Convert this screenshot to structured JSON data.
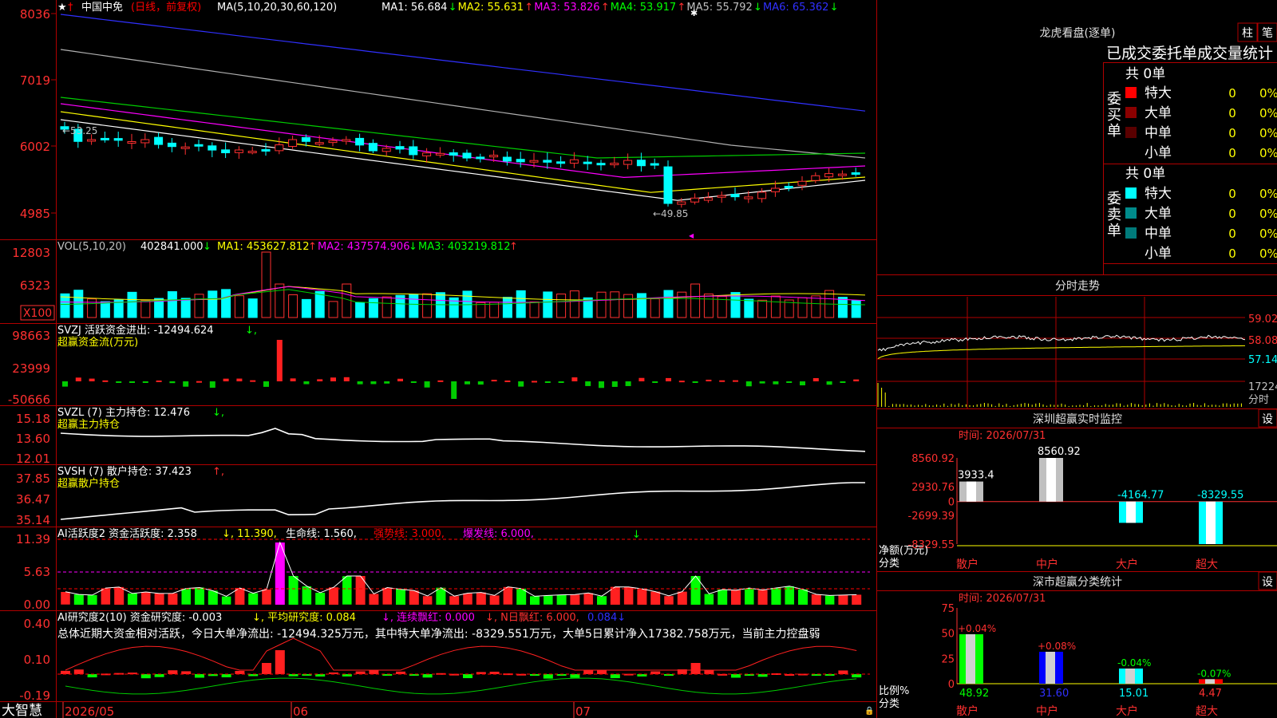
{
  "window": {
    "brand": "大智慧"
  },
  "main_chart": {
    "symbol": "中国中免",
    "mode": "(日线，前复权)",
    "ma_title": "MA(5,10,20,30,60,120)",
    "ma": [
      {
        "label": "MA1: 56.684",
        "arrow": "↓",
        "color": "#ffffff"
      },
      {
        "label": "MA2: 55.631",
        "arrow": "↑",
        "color": "#ffff00"
      },
      {
        "label": "MA3: 53.826",
        "arrow": "↑",
        "color": "#ff00ff"
      },
      {
        "label": "MA4: 53.917",
        "arrow": "↑",
        "color": "#00ff00"
      },
      {
        "label": "MA5: 55.792",
        "arrow": "↓",
        "color": "#c0c0c0"
      },
      {
        "label": "MA6: 65.362",
        "arrow": "↓",
        "color": "#3030ff"
      }
    ],
    "y_labels": [
      "8036",
      "7019",
      "6002",
      "4985"
    ],
    "high_label": "←53.25",
    "low_label": "←49.85"
  },
  "vol": {
    "title": "VOL(5,10,20)",
    "value": "402841.000",
    "value_arrow": "↓",
    "ma": [
      {
        "label": "MA1: 453627.812",
        "arrow": "↑",
        "color": "#ffff00"
      },
      {
        "label": "MA2: 437574.906",
        "arrow": "↓",
        "color": "#ff00ff"
      },
      {
        "label": "MA3: 403219.812",
        "arrow": "↑",
        "color": "#00ff00"
      }
    ],
    "y_labels": [
      "12803",
      "6323"
    ],
    "unit": "X100"
  },
  "svzj": {
    "title": "SVZJ  活跃资金进出: -12494.624",
    "arrow": "↓,",
    "subtitle": "超赢资金流(万元)",
    "y_labels": [
      "98663",
      "23999",
      "-50666"
    ]
  },
  "svzl": {
    "title": "SVZL (7) 主力持仓: 12.476",
    "arrow": "↓,",
    "subtitle": "超赢主力持仓",
    "y_labels": [
      "15.18",
      "13.60",
      "12.01"
    ]
  },
  "svsh": {
    "title": "SVSH (7) 散户持仓: 37.423",
    "arrow": "↑,",
    "subtitle": "超赢散户持仓",
    "y_labels": [
      "37.85",
      "36.47",
      "35.14"
    ]
  },
  "ai_active": {
    "title": "AI活跃度2 资金活跃度: 2.358",
    "v1": "↓, 11.390,",
    "v2": "生命线: 1.560,",
    "v3": "强势线: 3.000,",
    "v4": "爆发线: 6.000,",
    "y_labels": [
      "11.39",
      "5.63",
      "0.00"
    ]
  },
  "ai_research": {
    "title": "AI研究度2(10) 资金研究度: -0.003",
    "t2": "↓, 平均研究度: 0.084",
    "t3": "↓, 连续飘红: 0.000",
    "t4": "↓, N日飘红: 6.000,",
    "t5": "0.084↓",
    "summary": "总体近期大资金相对活跃，今日大单净流出: -12494.325万元，其中特大单净流出: -8329.551万元，大单5日累计净入17382.758万元，当前主力控盘弱",
    "y_labels": [
      "0.40",
      "0.10",
      "-0.19"
    ]
  },
  "x_axis": {
    "labels": [
      "2026/05",
      "06",
      "07"
    ]
  },
  "lhb": {
    "title": "龙虎看盘(逐单)",
    "btn1": "柱",
    "btn2": "笔",
    "header": "已成交委托单成交量统计",
    "buy_label": "委买单",
    "sell_label": "委卖单",
    "buy_total": "共 0单",
    "sell_total": "共 0单",
    "buy_rows": [
      {
        "name": "特大",
        "count": "0",
        "pct": "0%",
        "color": "#ff0000"
      },
      {
        "name": "大单",
        "count": "0",
        "pct": "0%",
        "color": "#8b0000"
      },
      {
        "name": "中单",
        "count": "0",
        "pct": "0%",
        "color": "#5a0000"
      },
      {
        "name": "小单",
        "count": "0",
        "pct": "0%",
        "color": ""
      }
    ],
    "sell_rows": [
      {
        "name": "特大",
        "count": "0",
        "pct": "0%",
        "color": "#00ffff"
      },
      {
        "name": "大单",
        "count": "0",
        "pct": "0%",
        "color": "#008b8b"
      },
      {
        "name": "中单",
        "count": "0",
        "pct": "0%",
        "color": "#007a7a"
      },
      {
        "name": "小单",
        "count": "0",
        "pct": "0%",
        "color": ""
      }
    ]
  },
  "fenshi": {
    "title": "分时走势",
    "y_labels": [
      "59.02",
      "58.08",
      "57.14"
    ],
    "vol_label": "17224",
    "tag": "分时"
  },
  "sz_monitor": {
    "title": "深圳超赢实时监控",
    "btn": "设",
    "date": "时间: 2026/07/31",
    "y_labels": [
      "8560.92",
      "2930.76",
      "0",
      "-2699.39",
      "-8329.55"
    ],
    "unit1": "净额(万元)",
    "unit2": "分类",
    "chart_data": {
      "type": "bar",
      "categories": [
        "散户",
        "中户",
        "大户",
        "超大"
      ],
      "values": [
        3933.4,
        8560.92,
        -4164.77,
        -8329.55
      ],
      "value_labels": [
        "3933.4",
        "8560.92",
        "-4164.77",
        "-8329.55"
      ],
      "ylim": [
        -8329.55,
        8560.92
      ]
    }
  },
  "sz_stats": {
    "title": "深市超赢分类统计",
    "btn": "设",
    "date": "时间: 2026/07/31",
    "y_labels": [
      "75",
      "50",
      "25",
      "0"
    ],
    "unit1": "比例%",
    "unit2": "分类",
    "chart_data": {
      "type": "bar",
      "categories": [
        "散户",
        "中户",
        "大户",
        "超大"
      ],
      "values": [
        48.92,
        31.6,
        15.01,
        4.47
      ],
      "value_labels": [
        "48.92",
        "31.60",
        "15.01",
        "4.47"
      ],
      "changes": [
        "+0.04%",
        "+0.08%",
        "-0.04%",
        "-0.07%"
      ],
      "ylim": [
        0,
        75
      ]
    }
  }
}
